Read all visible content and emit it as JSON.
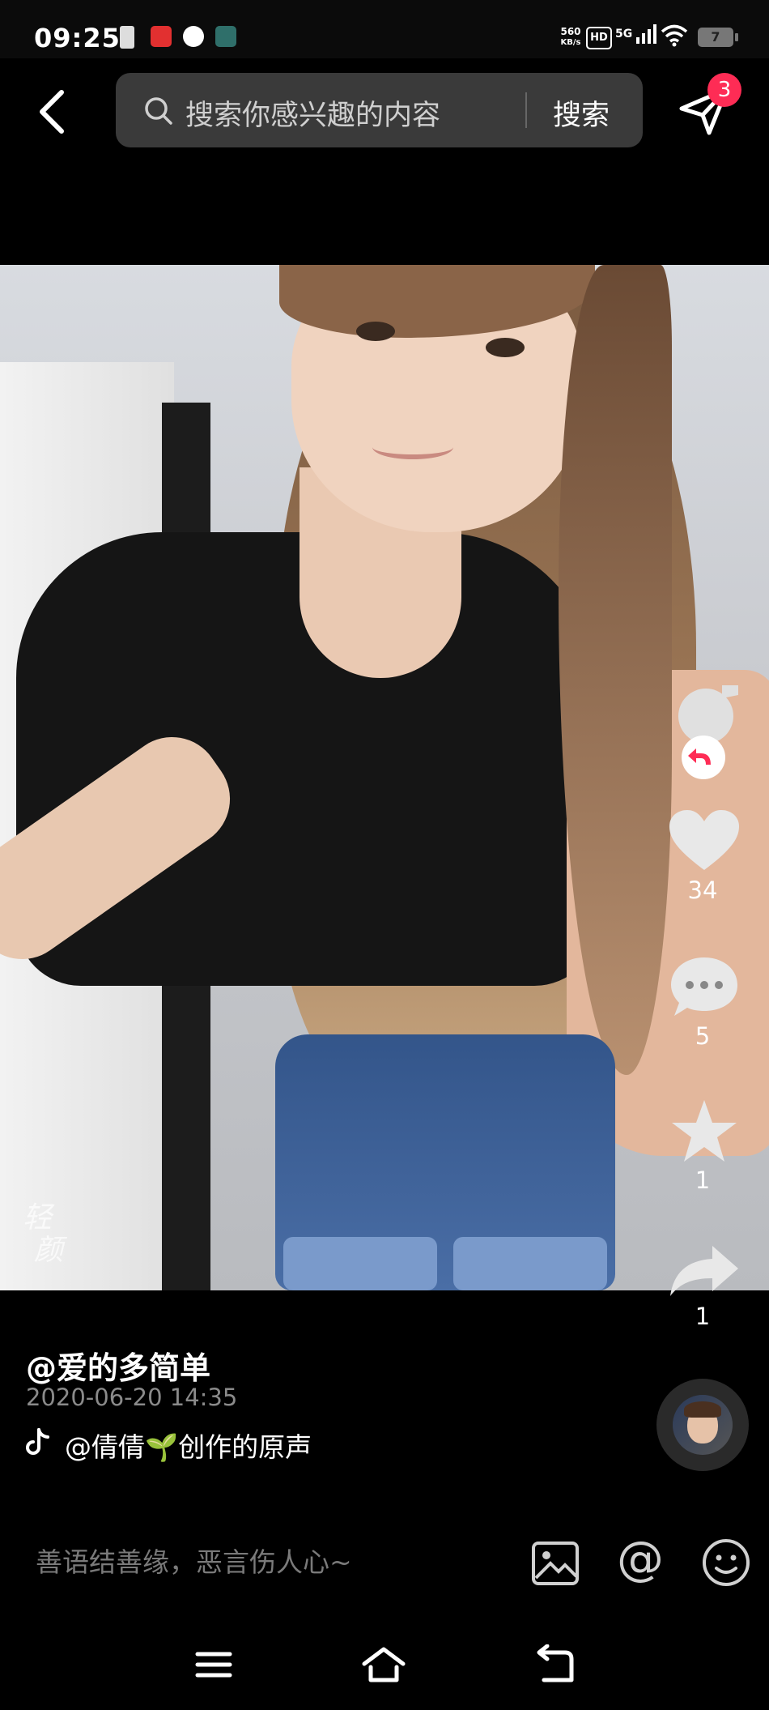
{
  "status_bar": {
    "time": "09:25",
    "net_speed_value": "560",
    "net_speed_unit": "KB/s",
    "hd": "HD",
    "network": "5G",
    "battery": "7"
  },
  "top_bar": {
    "search_placeholder": "搜索你感兴趣的内容",
    "search_button": "搜索",
    "notification_count": "3"
  },
  "video": {
    "watermark_line1": "轻",
    "watermark_line2": "颜"
  },
  "actions": {
    "likes": "34",
    "comments": "5",
    "favorites": "1",
    "shares": "1"
  },
  "post": {
    "author": "@爱的多简单",
    "date": "2020-06-20 14:35",
    "sound": "@倩倩🌱创作的原声"
  },
  "comment_bar": {
    "placeholder": "善语结善缘，恶言伤人心~"
  },
  "colors": {
    "accent": "#fe2c55",
    "background": "#000000"
  },
  "icons": [
    "back-icon",
    "search-icon",
    "share-icon",
    "music-disc-icon",
    "repost-icon",
    "heart-icon",
    "comment-icon",
    "star-icon",
    "forward-icon",
    "tiktok-icon",
    "image-icon",
    "at-icon",
    "emoji-icon",
    "menu-icon",
    "home-icon",
    "back-nav-icon"
  ]
}
